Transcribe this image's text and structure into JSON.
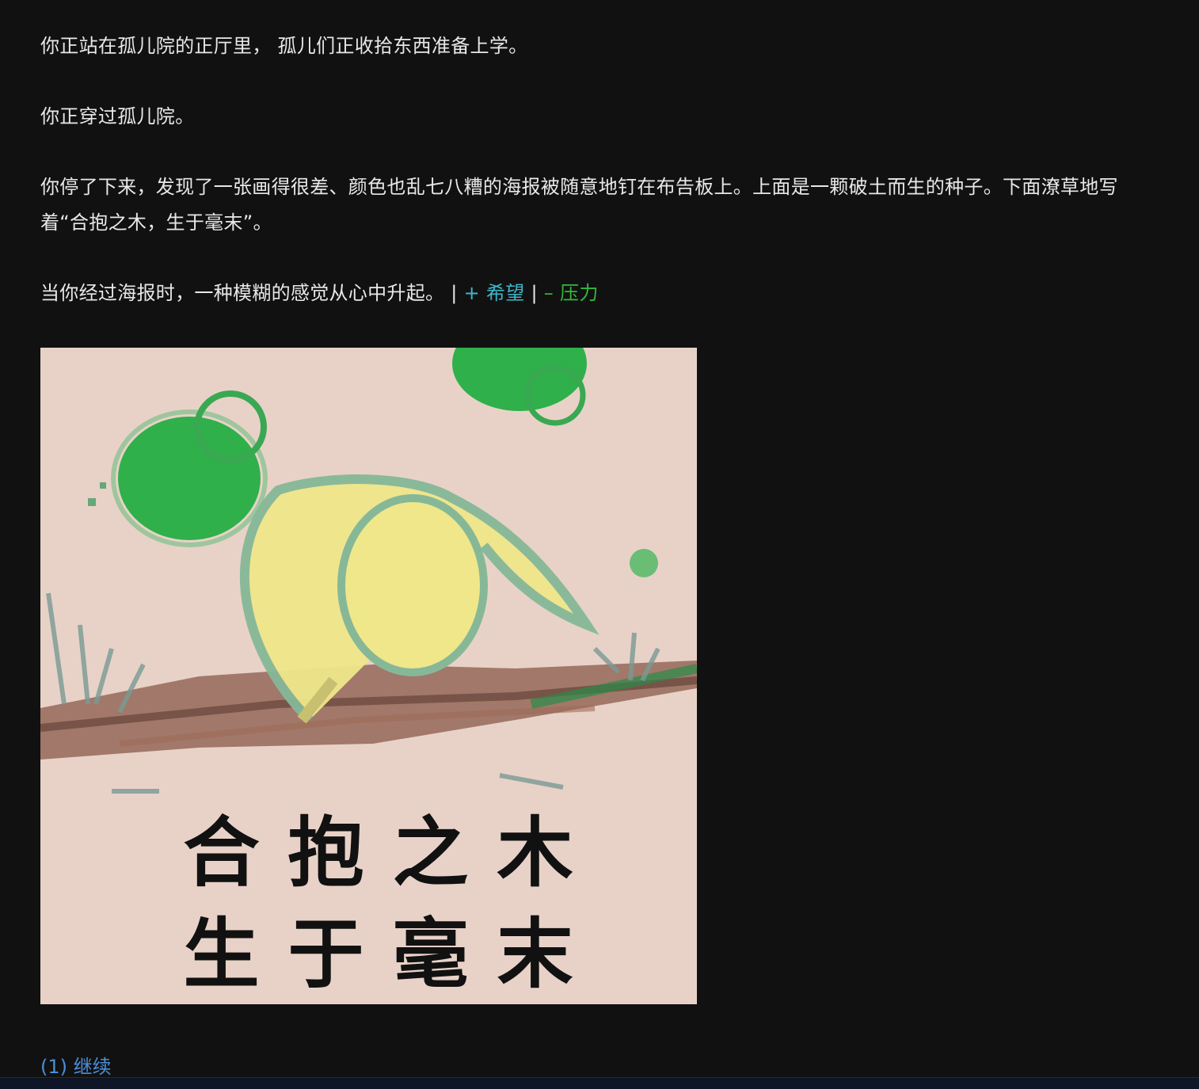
{
  "story": {
    "paragraphs": [
      "你正站在孤儿院的正厅里， 孤儿们正收拾东西准备上学。",
      "你正穿过孤儿院。",
      "你停了下来，发现了一张画得很差、颜色也乱七八糟的海报被随意地钉在布告板上。上面是一颗破土而生的种子。下面潦草地写着“合抱之木，生于毫末”。"
    ],
    "last_paragraph": "当你经过海报时，一种模糊的感觉从心中升起。",
    "stats": {
      "sep1": "|",
      "hope": "+ 希望",
      "sep2": "|",
      "stress": "– 压力"
    }
  },
  "poster": {
    "line1": "合抱之木",
    "line2": "生于毫末",
    "colors": {
      "background": "#e8d2c8",
      "leaf_green": "#2fb04a",
      "seed_yellow": "#efe78a",
      "soil_brown": "#8a5a4a"
    }
  },
  "choices": [
    {
      "label": "(1) 继续"
    }
  ]
}
